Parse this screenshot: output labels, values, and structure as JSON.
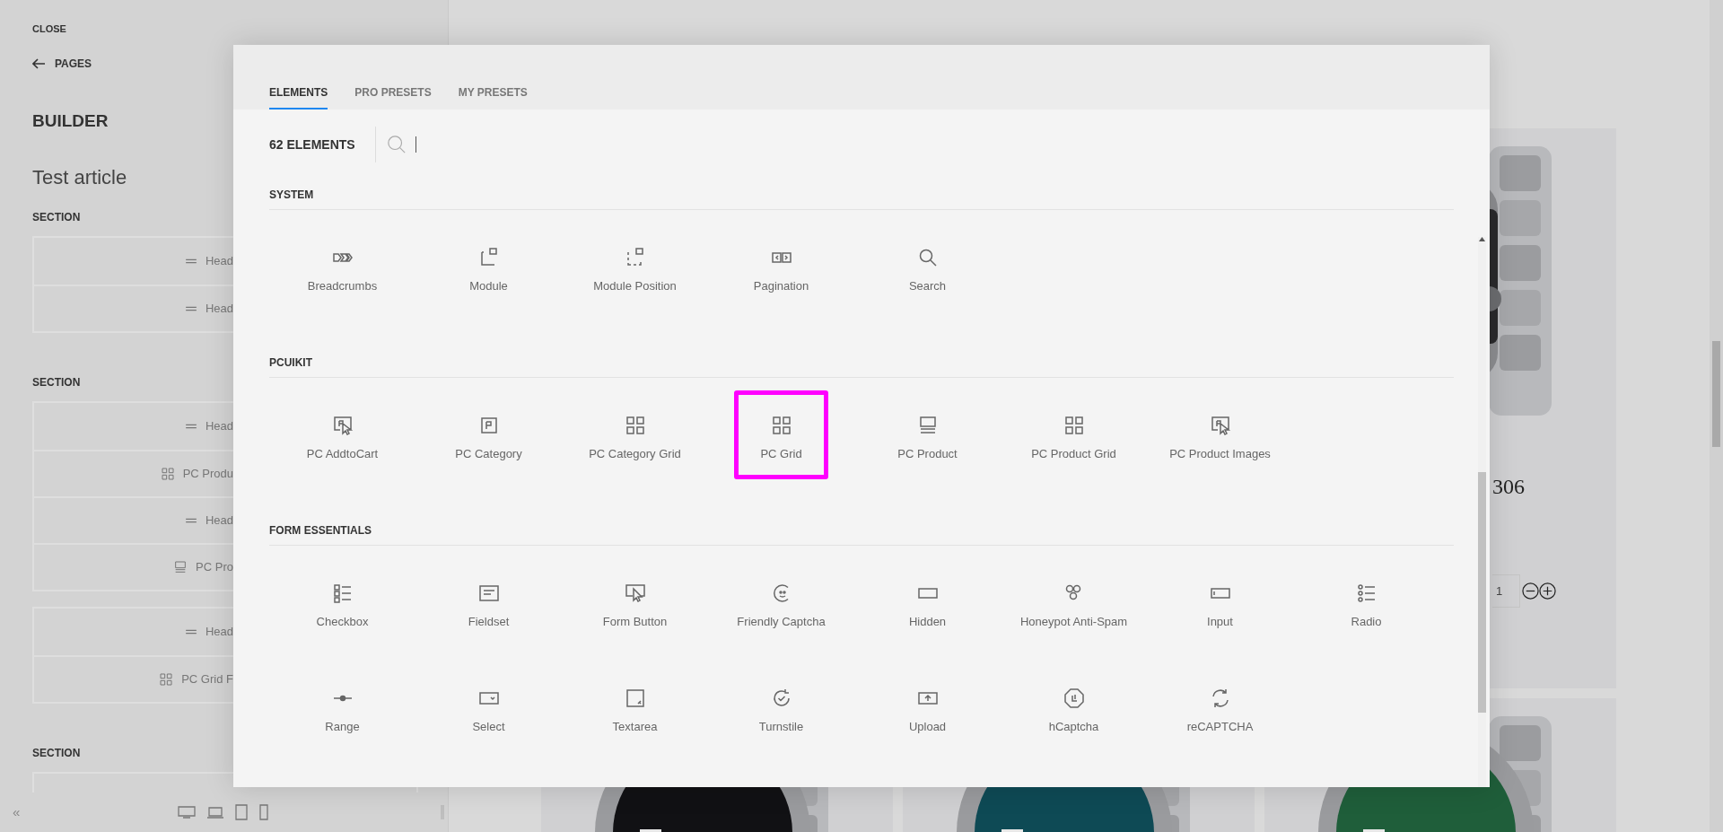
{
  "left_panel": {
    "close": "CLOSE",
    "back_link": "PAGES",
    "heading": "BUILDER",
    "page_title": "Test article",
    "sections": [
      {
        "title": "SECTION",
        "groups": [
          [
            {
              "kind": "heading",
              "label": "Head"
            },
            {
              "kind": "heading",
              "label": "Head"
            }
          ]
        ]
      },
      {
        "title": "SECTION",
        "groups": [
          [
            {
              "kind": "heading",
              "label": "Head"
            },
            {
              "kind": "product-grid",
              "label": "PC Produ"
            },
            {
              "kind": "heading",
              "label": "Head"
            },
            {
              "kind": "product",
              "label": "PC Pro"
            }
          ],
          [
            {
              "kind": "heading",
              "label": "Head"
            },
            {
              "kind": "product-grid",
              "label": "PC Grid F"
            }
          ]
        ]
      },
      {
        "title": "SECTION"
      }
    ],
    "collapse": "«"
  },
  "modal": {
    "tabs": [
      {
        "label": "ELEMENTS",
        "selected": true
      },
      {
        "label": "PRO PRESETS",
        "selected": false
      },
      {
        "label": "MY PRESETS",
        "selected": false
      }
    ],
    "count": "62 ELEMENTS",
    "groups": [
      {
        "title": "SYSTEM",
        "items": [
          {
            "kind": "breadcrumbs",
            "label": "Breadcrumbs",
            "highlighted": false
          },
          {
            "kind": "module",
            "label": "Module",
            "highlighted": false
          },
          {
            "kind": "module-position",
            "label": "Module Position",
            "highlighted": false
          },
          {
            "kind": "pagination",
            "label": "Pagination",
            "highlighted": false
          },
          {
            "kind": "search",
            "label": "Search",
            "highlighted": false
          }
        ]
      },
      {
        "title": "PCUIKIT",
        "items": [
          {
            "kind": "pc-cart",
            "label": "PC AddtoCart",
            "highlighted": false
          },
          {
            "kind": "pc-category",
            "label": "PC Category",
            "highlighted": false
          },
          {
            "kind": "grid",
            "label": "PC Category Grid",
            "highlighted": false
          },
          {
            "kind": "grid",
            "label": "PC Grid",
            "highlighted": true
          },
          {
            "kind": "product",
            "label": "PC Product",
            "highlighted": false
          },
          {
            "kind": "grid",
            "label": "PC Product Grid",
            "highlighted": false
          },
          {
            "kind": "pc-cart",
            "label": "PC Product Images",
            "highlighted": false
          }
        ]
      },
      {
        "title": "FORM ESSENTIALS",
        "items": [
          {
            "kind": "checkbox",
            "label": "Checkbox",
            "highlighted": false
          },
          {
            "kind": "fieldset",
            "label": "Fieldset",
            "highlighted": false
          },
          {
            "kind": "form-button",
            "label": "Form Button",
            "highlighted": false
          },
          {
            "kind": "captcha",
            "label": "Friendly Captcha",
            "highlighted": false
          },
          {
            "kind": "hidden",
            "label": "Hidden",
            "highlighted": false
          },
          {
            "kind": "honeycomb",
            "label": "Honeypot Anti-Spam",
            "highlighted": false
          },
          {
            "kind": "input",
            "label": "Input",
            "highlighted": false
          },
          {
            "kind": "radio",
            "label": "Radio",
            "highlighted": false
          },
          {
            "kind": "range",
            "label": "Range",
            "highlighted": false
          },
          {
            "kind": "select",
            "label": "Select",
            "highlighted": false
          },
          {
            "kind": "textarea",
            "label": "Textarea",
            "highlighted": false
          },
          {
            "kind": "turnstile",
            "label": "Turnstile",
            "highlighted": false
          },
          {
            "kind": "upload",
            "label": "Upload",
            "highlighted": false
          },
          {
            "kind": "hcaptcha",
            "label": "hCaptcha",
            "highlighted": false
          },
          {
            "kind": "recaptcha",
            "label": "reCAPTCHA",
            "highlighted": false
          }
        ]
      }
    ]
  },
  "page": {
    "product": {
      "title": "306",
      "quantity": "1"
    }
  }
}
